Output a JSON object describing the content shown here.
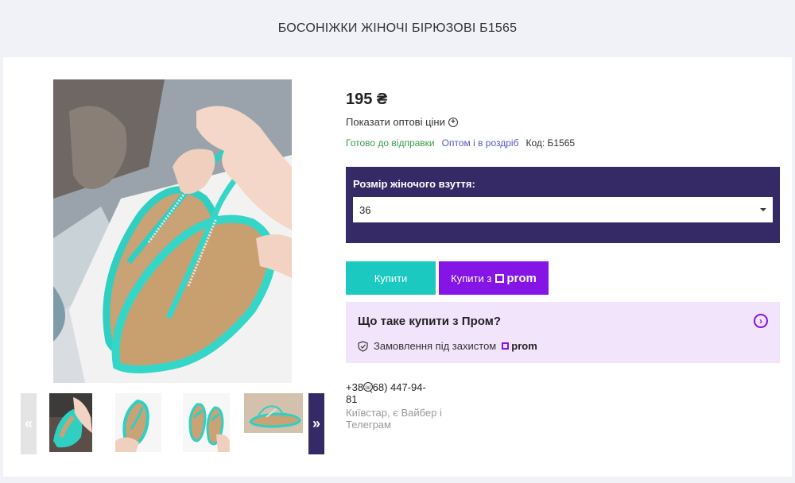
{
  "page": {
    "title": "БОСОНІЖКИ ЖІНОЧІ БІРЮЗОВІ Б1565"
  },
  "product": {
    "price": "195 ₴",
    "wholesale_link": "Показати оптові ціни",
    "status_ready": "Готово до відправки",
    "status_wholesale": "Оптом і в роздріб",
    "code": "Код: Б1565"
  },
  "size": {
    "label": "Розмір жіночого взуття:",
    "selected": "36"
  },
  "actions": {
    "buy_label": "Купити",
    "buy_prom_label": "Купити з",
    "prom_brand": "prom"
  },
  "prom_info": {
    "title": "Що таке купити з Пром?",
    "protection": "Замовлення під захистом",
    "brand": "prom"
  },
  "contact": {
    "phone": "+380(68) 447-94-81",
    "note": "Київстар, є Вайбер і Телеграм"
  },
  "gallery": {
    "prev_arrow": "«",
    "next_arrow": "»",
    "thumbnail_count": 4
  },
  "colors": {
    "accent_dark": "#362a66",
    "buy_teal": "#1cc9c0",
    "prom_purple": "#8514e6",
    "info_bg": "#f1e4fb",
    "status_green": "#3b9a48",
    "status_blue": "#5455c4"
  }
}
